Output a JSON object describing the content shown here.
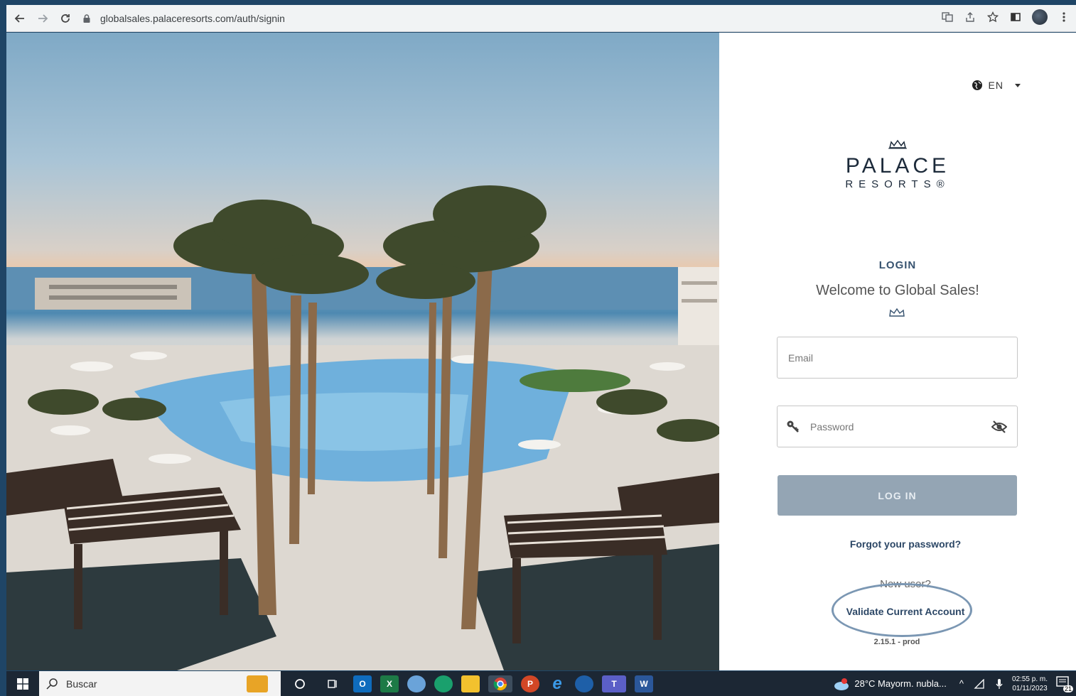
{
  "browser": {
    "url": "globalsales.palaceresorts.com/auth/signin"
  },
  "lang": {
    "label": "EN"
  },
  "logo": {
    "line1": "PALACE",
    "line2": "RESORTS®"
  },
  "login": {
    "title": "LOGIN",
    "welcome": "Welcome to Global Sales!",
    "email_placeholder": "Email",
    "password_placeholder": "Password",
    "login_button": "LOG IN",
    "forgot": "Forgot your password?",
    "new_user": "New user?",
    "validate": "Validate Current Account",
    "version": "2.15.1 - prod"
  },
  "taskbar": {
    "search_placeholder": "Buscar",
    "weather": "28°C  Mayorm. nubla...",
    "time": "02:55 p. m.",
    "date": "01/11/2023",
    "notification_count": "21"
  }
}
